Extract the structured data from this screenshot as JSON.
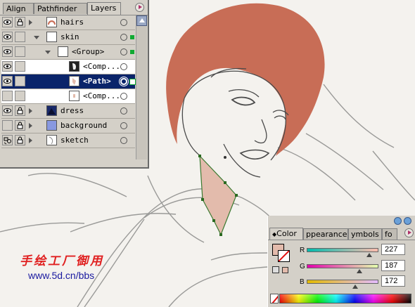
{
  "colors": {
    "hair": "#c86d56",
    "skin": "#e3bbac",
    "selection": "#0a246a",
    "path_stroke": "#3a7a30"
  },
  "layers_panel": {
    "tabs": [
      "Align",
      "Pathfinder",
      "Layers"
    ],
    "active_tab": "Layers",
    "rows": [
      {
        "name": "hairs",
        "visible": true,
        "locked": true,
        "expand": "collapsed",
        "level": 0,
        "thumb": "hair-thumb",
        "selected_marker": false
      },
      {
        "name": "skin",
        "visible": true,
        "locked": false,
        "expand": "expanded",
        "level": 0,
        "thumb": "skin-thumb",
        "selected_marker": true
      },
      {
        "name": "<Group>",
        "visible": true,
        "locked": false,
        "expand": "expanded",
        "level": 1,
        "thumb": "blank-thumb",
        "selected_marker": true
      },
      {
        "name": "<Comp...",
        "visible": true,
        "locked": false,
        "expand": "none",
        "level": 2,
        "thumb": "face-thumb",
        "selected_marker": false
      },
      {
        "name": "<Path>",
        "visible": true,
        "locked": false,
        "expand": "none",
        "level": 2,
        "thumb": "neck-thumb",
        "selected_marker": true,
        "highlighted": true
      },
      {
        "name": "<Comp...",
        "visible": false,
        "locked": false,
        "expand": "none",
        "level": 2,
        "thumb": "small-thumb",
        "selected_marker": false
      },
      {
        "name": "dress",
        "visible": true,
        "locked": true,
        "expand": "collapsed",
        "level": 0,
        "thumb": "dress-thumb",
        "selected_marker": false
      },
      {
        "name": "background",
        "visible": false,
        "locked": true,
        "expand": "collapsed",
        "level": 0,
        "thumb": "bg-thumb",
        "selected_marker": false
      },
      {
        "name": "sketch",
        "visible": true,
        "locked": true,
        "expand": "collapsed",
        "level": 0,
        "thumb": "sketch-thumb",
        "selected_marker": false
      }
    ]
  },
  "color_panel": {
    "tabs": [
      "Color",
      "ppearance",
      "ymbols",
      "fo"
    ],
    "active_tab": "Color",
    "channels": [
      {
        "label": "R",
        "value": "227"
      },
      {
        "label": "G",
        "value": "187"
      },
      {
        "label": "B",
        "value": "172"
      }
    ]
  },
  "watermark": {
    "chinese": "手绘工厂御用",
    "url": "www.5d.cn/bbs"
  }
}
